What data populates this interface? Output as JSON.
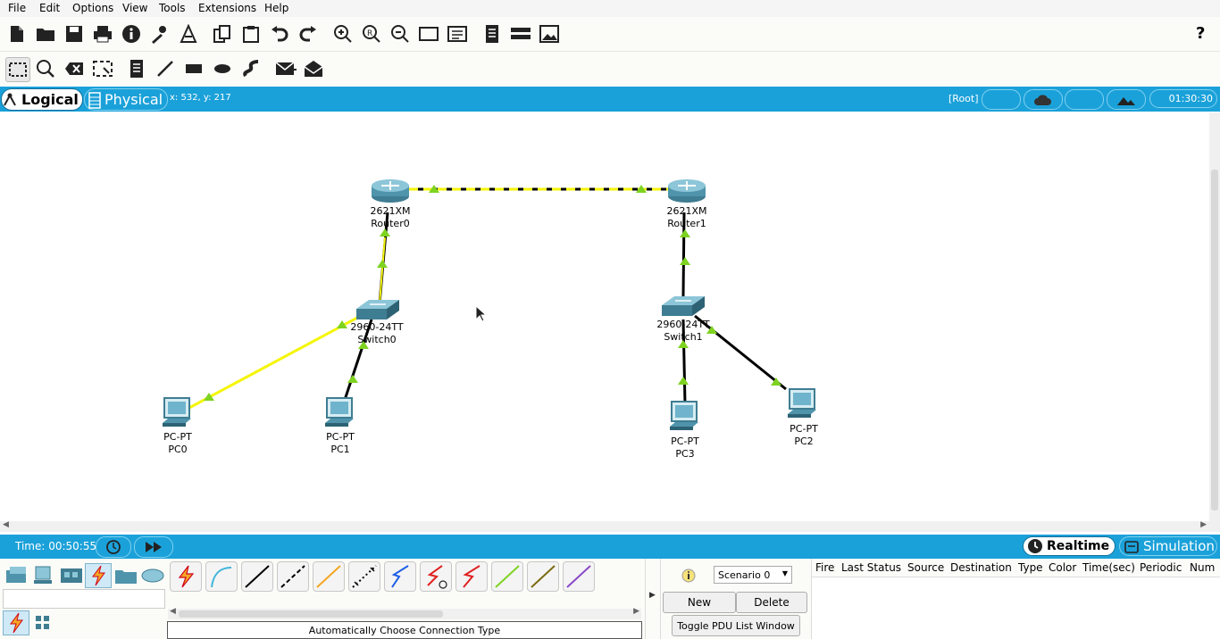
{
  "menu": [
    "File",
    "Edit",
    "Options",
    "View",
    "Tools",
    "Extensions",
    "Help"
  ],
  "toolbar1_icons": [
    "new-file-icon",
    "open-folder-icon",
    "save-icon",
    "print-icon",
    "info-icon",
    "activity-wizard-icon",
    "custom-devices-icon",
    "copy-icon",
    "paste-icon",
    "undo-icon",
    "redo-icon",
    "zoom-in-icon",
    "zoom-reset-icon",
    "zoom-out-icon",
    "drawing-palette-icon",
    "custom-device-dialog-icon",
    "pdu-viewer-icon",
    "network-info-icon",
    "screenshot-icon"
  ],
  "help_glyph": "?",
  "toolbar2_icons": [
    "select-icon",
    "inspect-icon",
    "delete-icon",
    "resize-icon",
    "note-icon",
    "draw-line-icon",
    "rectangle-icon",
    "ellipse-icon",
    "freeform-icon",
    "simple-pdu-icon",
    "complex-pdu-icon"
  ],
  "tabs": {
    "logical": "Logical",
    "physical": "Physical",
    "coords": "x: 532, y: 217"
  },
  "workspace": {
    "root": "[Root]",
    "clock": "01:30:30"
  },
  "devices": [
    {
      "model": "2621XM",
      "name": "Router0",
      "kind": "router"
    },
    {
      "model": "2621XM",
      "name": "Router1",
      "kind": "router"
    },
    {
      "model": "2960-24TT",
      "name": "Switch0",
      "kind": "switch"
    },
    {
      "model": "2960-24TT",
      "name": "Switch1",
      "kind": "switch"
    },
    {
      "model": "PC-PT",
      "name": "PC0",
      "kind": "pc"
    },
    {
      "model": "PC-PT",
      "name": "PC1",
      "kind": "pc"
    },
    {
      "model": "PC-PT",
      "name": "PC3",
      "kind": "pc"
    },
    {
      "model": "PC-PT",
      "name": "PC2",
      "kind": "pc"
    }
  ],
  "timebar": {
    "time": "Time: 00:50:55",
    "realtime": "Realtime",
    "simulation": "Simulation"
  },
  "device_categories": [
    "network-devices-icon",
    "end-devices-icon",
    "components-icon",
    "connections-icon",
    "miscellaneous-icon",
    "multiuser-icon"
  ],
  "cable_types": [
    "auto-connection-icon",
    "console-cable-icon",
    "copper-straight-icon",
    "copper-cross-icon",
    "fiber-icon",
    "phone-cable-icon",
    "coaxial-cable-icon",
    "serial-dce-icon",
    "serial-dte-icon",
    "octal-cable-icon",
    "iot-custom-cable-icon",
    "usb-cable-icon"
  ],
  "connection_caption": "Automatically Choose Connection Type",
  "scenario": {
    "selected": "Scenario 0",
    "new": "New",
    "delete": "Delete",
    "toggle": "Toggle PDU List Window"
  },
  "pdu_columns": [
    "Fire",
    "Last Status",
    "Source",
    "Destination",
    "Type",
    "Color",
    "Time(sec)",
    "Periodic",
    "Num"
  ],
  "colors": {
    "accent": "#1ba1d9",
    "link_green": "#7ed321",
    "link_yellow": "#f5f50a"
  }
}
